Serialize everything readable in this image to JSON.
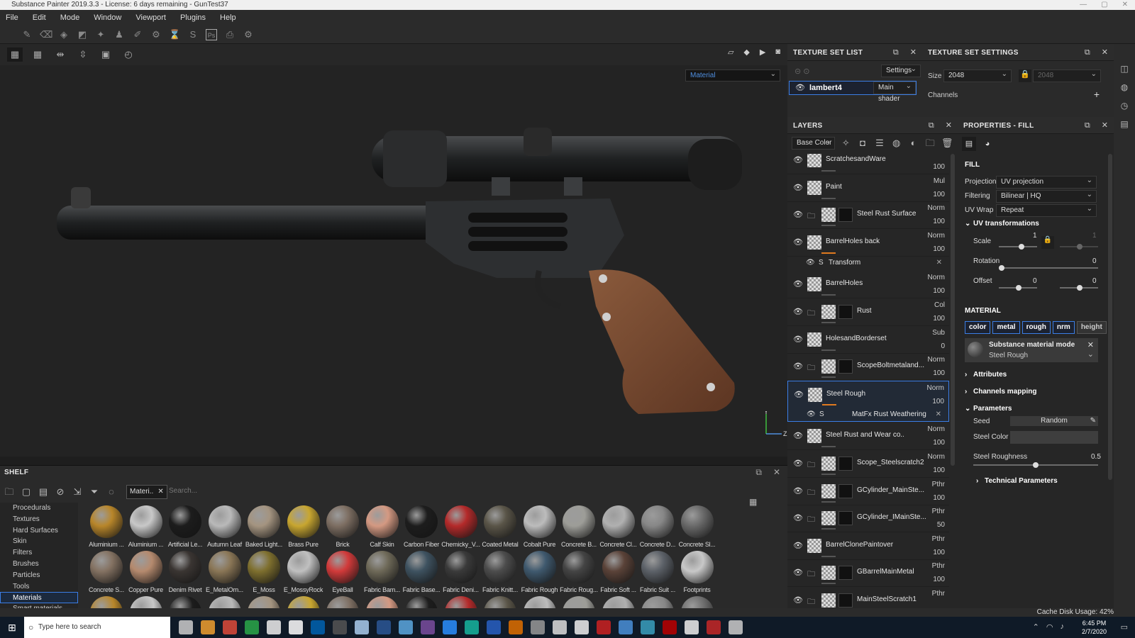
{
  "window": {
    "title": "Substance Painter 2019.3.3 - License: 6 days remaining - GunTest37"
  },
  "menu": [
    "File",
    "Edit",
    "Mode",
    "Window",
    "Viewport",
    "Plugins",
    "Help"
  ],
  "viewport": {
    "channel_select": "Material"
  },
  "texture_set_list": {
    "title": "TEXTURE SET LIST",
    "settings_label": "Settings",
    "item_name": "lambert4",
    "shader": "Main shader"
  },
  "texture_set_settings": {
    "title": "TEXTURE SET SETTINGS",
    "size_label": "Size",
    "size_value": "2048",
    "size_locked_value": "2048",
    "channels_label": "Channels"
  },
  "layers": {
    "title": "LAYERS",
    "channel": "Base Color",
    "items": [
      {
        "name": "ScratchesandWare",
        "blend": "",
        "opacity": "100",
        "folder": false,
        "partial": true
      },
      {
        "name": "Paint",
        "blend": "Mul",
        "opacity": "100",
        "folder": false
      },
      {
        "name": "Steel Rust Surface",
        "blend": "Norm",
        "opacity": "100",
        "folder": true
      },
      {
        "name": "BarrelHoles back",
        "blend": "Norm",
        "opacity": "100",
        "folder": false,
        "sub": "Transform"
      },
      {
        "name": "BarrelHoles",
        "blend": "Norm",
        "opacity": "100",
        "folder": false
      },
      {
        "name": "Rust",
        "blend": "Col",
        "opacity": "100",
        "folder": true
      },
      {
        "name": "HolesandBorderset",
        "blend": "Sub",
        "opacity": "0",
        "folder": false
      },
      {
        "name": "ScopeBoltmetaland...",
        "blend": "Norm",
        "opacity": "100",
        "folder": true
      },
      {
        "name": "Steel Rough",
        "blend": "Norm",
        "opacity": "100",
        "folder": false,
        "selected": true,
        "sub": "MatFx Rust Weathering"
      },
      {
        "name": "Steel Rust and Wear co...",
        "blend": "Norm",
        "opacity": "100",
        "folder": false
      },
      {
        "name": "Scope_Steelscratch2",
        "blend": "Norm",
        "opacity": "100",
        "folder": true
      },
      {
        "name": "GCylinder_MainSte...",
        "blend": "Pthr",
        "opacity": "100",
        "folder": true
      },
      {
        "name": "GCylinder_IMainSte...",
        "blend": "Pthr",
        "opacity": "50",
        "folder": true
      },
      {
        "name": "BarrelClonePaintover",
        "blend": "Pthr",
        "opacity": "100",
        "folder": false
      },
      {
        "name": "GBarrelMainMetal",
        "blend": "Pthr",
        "opacity": "100",
        "folder": true
      },
      {
        "name": "MainSteelScratch1",
        "blend": "Pthr",
        "opacity": "",
        "folder": true
      }
    ]
  },
  "properties": {
    "title": "PROPERTIES - FILL",
    "fill_label": "FILL",
    "projection_label": "Projection",
    "projection": "UV projection",
    "filtering_label": "Filtering",
    "filtering": "Bilinear | HQ",
    "uvwrap_label": "UV Wrap",
    "uvwrap": "Repeat",
    "uvt_label": "UV transformations",
    "scale_label": "Scale",
    "scale_value": "1",
    "scale_value2": "1",
    "rotation_label": "Rotation",
    "rotation_value": "0",
    "offset_label": "Offset",
    "offset_x": "0",
    "offset_y": "0",
    "material_label": "MATERIAL",
    "chips": [
      "color",
      "metal",
      "rough",
      "nrm",
      "height"
    ],
    "mode_title": "Substance material mode",
    "mode_value": "Steel Rough",
    "attributes": "Attributes",
    "channels_mapping": "Channels mapping",
    "parameters": "Parameters",
    "seed_label": "Seed",
    "seed_value": "Random",
    "steel_color_label": "Steel Color",
    "steel_rough_label": "Steel Roughness",
    "steel_rough_value": "0.5",
    "technical": "Technical Parameters"
  },
  "shelf": {
    "title": "SHELF",
    "filter": "Materi..",
    "search_placeholder": "Search...",
    "categories": [
      "Procedurals",
      "Textures",
      "Hard Surfaces",
      "Skin",
      "Filters",
      "Brushes",
      "Particles",
      "Tools",
      "Materials",
      "Smart materials"
    ],
    "selected_category": "Materials",
    "materials_row1": [
      "Aluminium ...",
      "Aluminium ...",
      "Artificial Le...",
      "Autumn Leaf",
      "Baked Light...",
      "Brass Pure",
      "Brick",
      "Calf Skin",
      "Carbon Fiber",
      "Chemicky_V...",
      "Coated Metal",
      "Cobalt Pure",
      "Concrete B...",
      "Concrete Cl...",
      "Concrete D...",
      "Concrete Sl..."
    ],
    "materials_row2": [
      "Concrete S...",
      "Copper Pure",
      "Denim Rivet",
      "E_MetalOrn...",
      "E_Moss",
      "E_MossyRock",
      "EyeBall",
      "Fabric Bam...",
      "Fabric Base...",
      "Fabric Deni...",
      "Fabric Knitt...",
      "Fabric Rough",
      "Fabric Roug...",
      "Fabric Soft ...",
      "Fabric Suit ...",
      "Footprints"
    ]
  },
  "status": {
    "cache": "Cache Disk Usage: 42%"
  },
  "taskbar": {
    "search_placeholder": "Type here to search",
    "time": "6:45 PM",
    "date": "2/7/2020"
  }
}
